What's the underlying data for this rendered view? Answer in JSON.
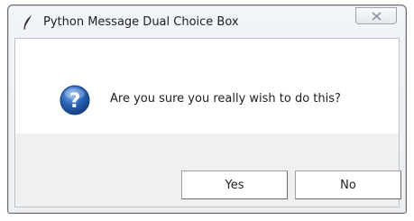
{
  "window": {
    "title": "Python Message Dual Choice Box",
    "close_icon": "close-icon",
    "app_icon": "feather-icon"
  },
  "dialog": {
    "icon": "question-icon",
    "message": "Are you sure you really wish to do this?"
  },
  "buttons": {
    "yes_label": "Yes",
    "no_label": "No"
  },
  "colors": {
    "question_icon": "#2a63b8",
    "button_bar": "#f0f0f0"
  }
}
